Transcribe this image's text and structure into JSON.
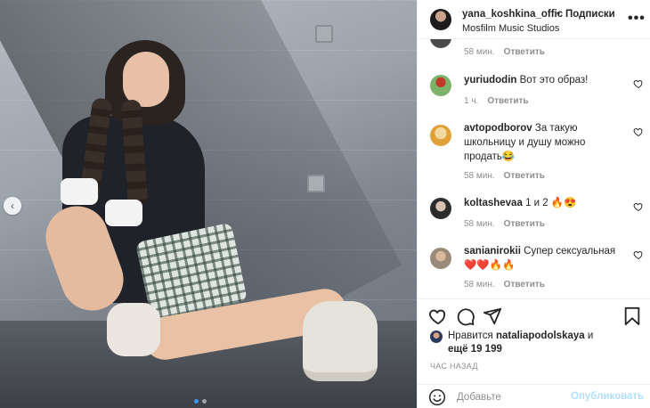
{
  "post": {
    "username": "yana_koshkina_offic",
    "separator": "•",
    "follow_label": "Подписки",
    "location": "Mosfilm Music Studios",
    "more_label": "•••"
  },
  "carousel": {
    "prev_label": "‹",
    "dots": 2,
    "active_dot": 0
  },
  "comments": [
    {
      "username": "",
      "text": "",
      "time": "58 мин.",
      "reply": "Ответить",
      "avatar_color": "#4a4a4a"
    },
    {
      "username": "yuriudodin",
      "text": "Вот это образ!",
      "time": "1 ч.",
      "reply": "Ответить",
      "avatar_color": "#7bb36a"
    },
    {
      "username": "avtopodborov",
      "text": "За такую школьницу и душу можно продать😂",
      "time": "58 мин.",
      "reply": "Ответить",
      "avatar_color": "#e0a13a"
    },
    {
      "username": "koltashevaa",
      "text": "1 и 2 🔥😍",
      "time": "58 мин.",
      "reply": "Ответить",
      "avatar_color": "#2c2c2c"
    },
    {
      "username": "sanianirokii",
      "text": "Супер сексуальная ❤️❤️🔥🔥",
      "time": "58 мин.",
      "reply": "Ответить",
      "avatar_color": "#9a8a7a"
    }
  ],
  "likes": {
    "prefix": "Нравится",
    "user": "nataliapodolskaya",
    "joiner": "и",
    "rest": "ещё 19 199"
  },
  "timestamp": "ЧАС НАЗАД",
  "composer": {
    "placeholder": "Добавьте",
    "publish_label": "Опубликовать"
  },
  "colors": {
    "link_blue": "#3897f0",
    "publish_disabled": "#b2dffc",
    "meta_gray": "#8e8e8e"
  }
}
